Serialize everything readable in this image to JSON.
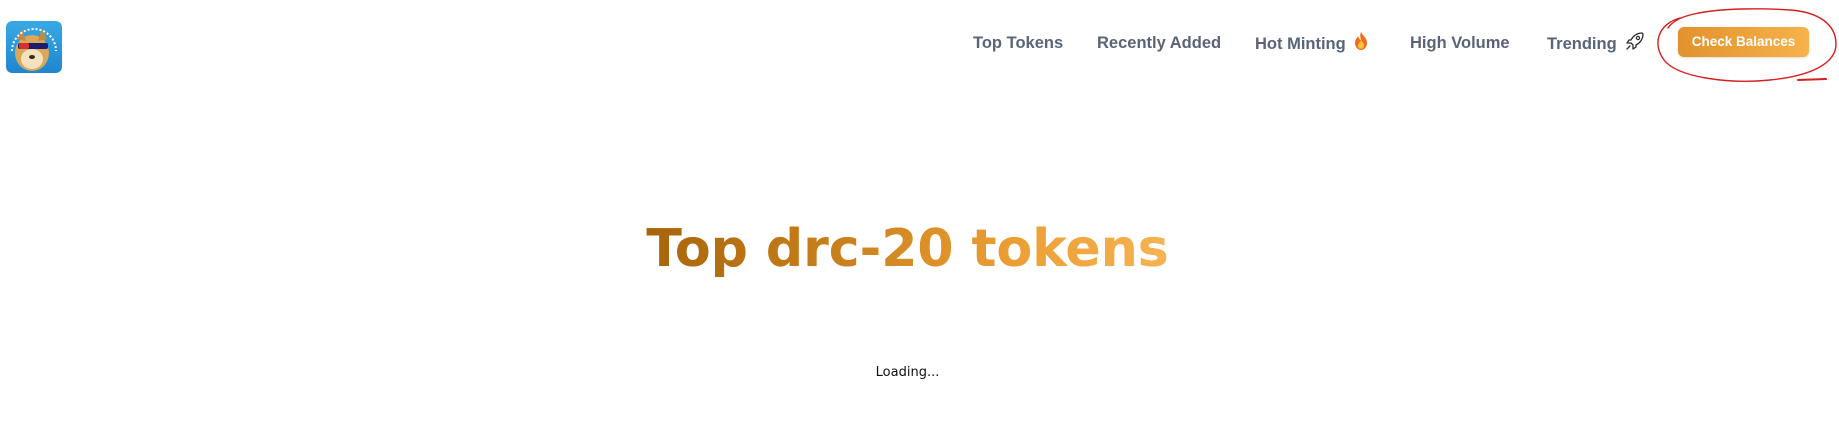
{
  "header": {
    "logo_text": "DOGE",
    "nav": [
      {
        "label": "Top Tokens",
        "emoji": ""
      },
      {
        "label": "Recently Added",
        "emoji": ""
      },
      {
        "label": "Hot Minting",
        "emoji": "fire-icon"
      },
      {
        "label": "High Volume",
        "emoji": ""
      },
      {
        "label": "Trending",
        "emoji": "rocket-icon"
      }
    ],
    "cta_label": "Check Balances"
  },
  "main": {
    "title": "Top drc-20 tokens",
    "loading_text": "Loading..."
  },
  "colors": {
    "nav_text": "#5a6478",
    "accent_start": "#e2922d",
    "accent_end": "#f6b24b",
    "title_start": "#a8640c",
    "title_end": "#f7b352",
    "annotation": "#d81e1e"
  }
}
